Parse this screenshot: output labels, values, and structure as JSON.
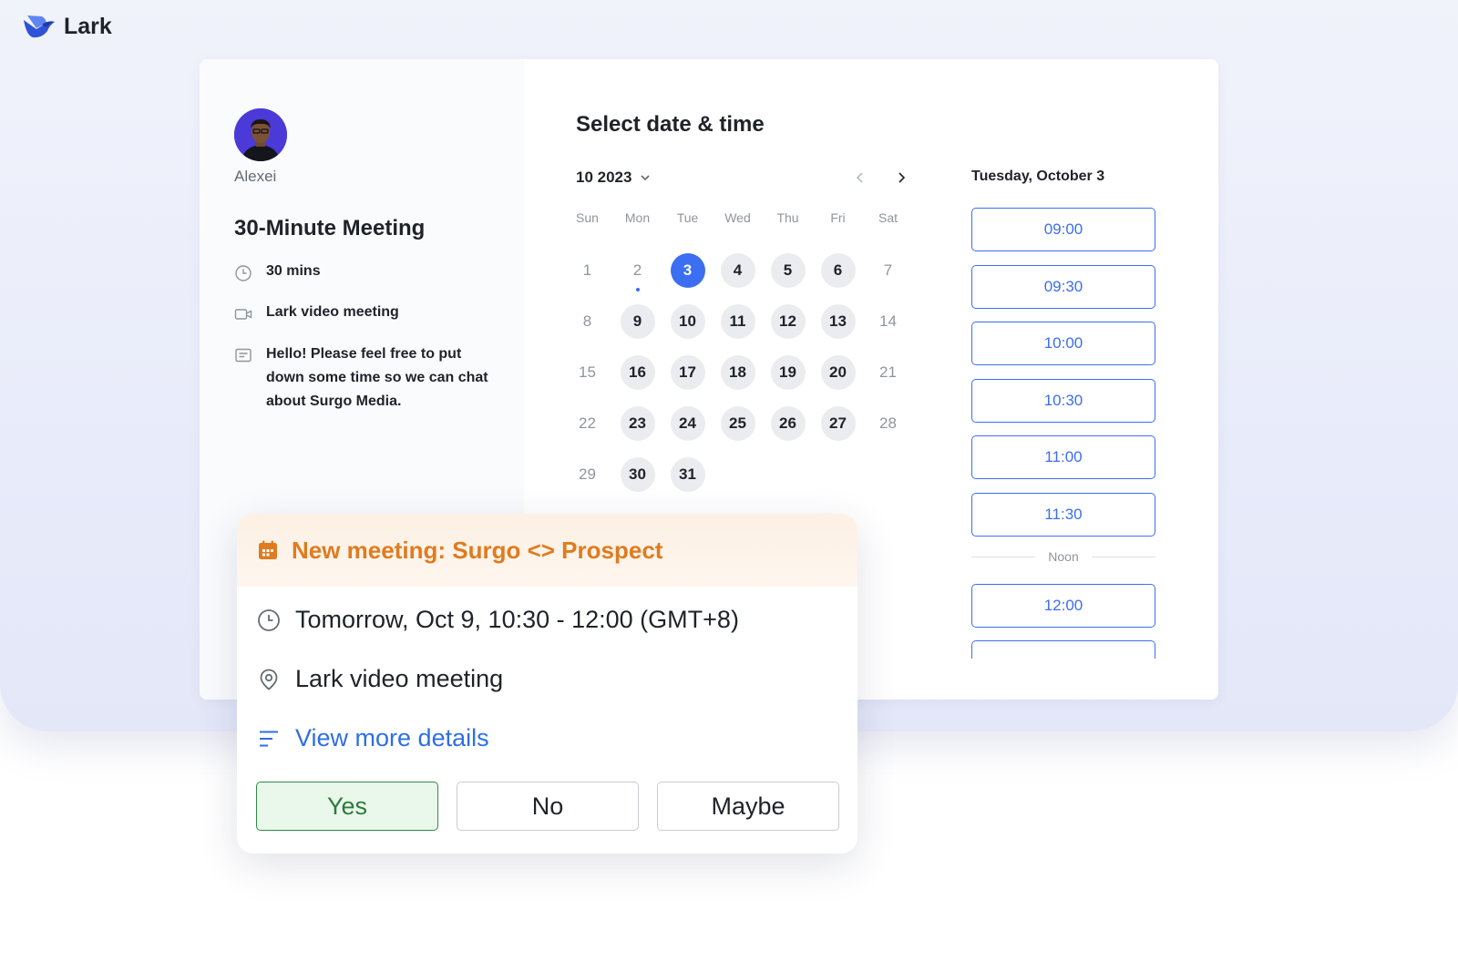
{
  "brand": {
    "name": "Lark"
  },
  "host": {
    "name": "Alexei"
  },
  "meeting": {
    "title": "30-Minute Meeting",
    "duration": "30 mins",
    "location": "Lark video meeting",
    "description": "Hello! Please feel free to put down some time so we can chat about Surgo Media."
  },
  "scheduler": {
    "title": "Select date & time",
    "month_label": "10 2023",
    "weekdays": [
      "Sun",
      "Mon",
      "Tue",
      "Wed",
      "Thu",
      "Fri",
      "Sat"
    ],
    "weeks": [
      [
        {
          "d": "1",
          "s": "muted"
        },
        {
          "d": "2",
          "s": "muted",
          "dot": true
        },
        {
          "d": "3",
          "s": "selected"
        },
        {
          "d": "4",
          "s": "available"
        },
        {
          "d": "5",
          "s": "available"
        },
        {
          "d": "6",
          "s": "available"
        },
        {
          "d": "7",
          "s": "muted"
        }
      ],
      [
        {
          "d": "8",
          "s": "muted"
        },
        {
          "d": "9",
          "s": "available"
        },
        {
          "d": "10",
          "s": "available"
        },
        {
          "d": "11",
          "s": "available"
        },
        {
          "d": "12",
          "s": "available"
        },
        {
          "d": "13",
          "s": "available"
        },
        {
          "d": "14",
          "s": "muted"
        }
      ],
      [
        {
          "d": "15",
          "s": "muted"
        },
        {
          "d": "16",
          "s": "available"
        },
        {
          "d": "17",
          "s": "available"
        },
        {
          "d": "18",
          "s": "available"
        },
        {
          "d": "19",
          "s": "available"
        },
        {
          "d": "20",
          "s": "available"
        },
        {
          "d": "21",
          "s": "muted"
        }
      ],
      [
        {
          "d": "22",
          "s": "muted"
        },
        {
          "d": "23",
          "s": "available"
        },
        {
          "d": "24",
          "s": "available"
        },
        {
          "d": "25",
          "s": "available"
        },
        {
          "d": "26",
          "s": "available"
        },
        {
          "d": "27",
          "s": "available"
        },
        {
          "d": "28",
          "s": "muted"
        }
      ],
      [
        {
          "d": "29",
          "s": "muted"
        },
        {
          "d": "30",
          "s": "available"
        },
        {
          "d": "31",
          "s": "available"
        },
        {
          "d": "",
          "s": "empty"
        },
        {
          "d": "",
          "s": "empty"
        },
        {
          "d": "",
          "s": "empty"
        },
        {
          "d": "",
          "s": "empty"
        }
      ]
    ],
    "selected_date_label": "Tuesday, October 3",
    "morning_slots": [
      "09:00",
      "09:30",
      "10:00",
      "10:30",
      "11:00",
      "11:30"
    ],
    "divider_label": "Noon",
    "afternoon_slots": [
      "12:00"
    ]
  },
  "notification": {
    "title": "New meeting: Surgo <> Prospect",
    "time": "Tomorrow, Oct 9, 10:30 - 12:00 (GMT+8)",
    "location": "Lark video meeting",
    "details_link": "View more details",
    "rsvp": {
      "yes": "Yes",
      "no": "No",
      "maybe": "Maybe"
    }
  },
  "colors": {
    "accent": "#3b6ef0",
    "notification_accent": "#e07b1f",
    "yes_green": "#2e8b45"
  },
  "icons": {
    "brand": "lark-logo-icon",
    "duration": "clock-icon",
    "location": "video-camera-icon",
    "description": "notes-icon",
    "calendar": "calendar-icon",
    "pin": "location-pin-icon",
    "details": "list-icon"
  }
}
